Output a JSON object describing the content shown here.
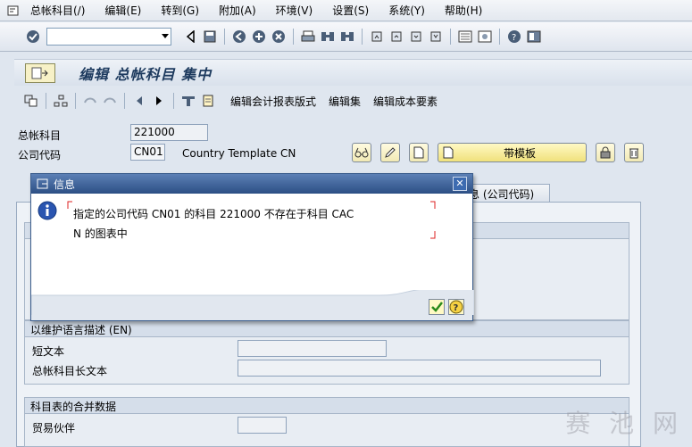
{
  "menu": {
    "items": [
      "总帐科目(/)",
      "编辑(E)",
      "转到(G)",
      "附加(A)",
      "环境(V)",
      "设置(S)",
      "系统(Y)",
      "帮助(H)"
    ]
  },
  "command_field": {
    "value": ""
  },
  "title": "编辑 总帐科目 集中",
  "app_toolbar": {
    "layout_btn": "编辑会计报表版式",
    "set_btn": "编辑集",
    "cost_btn": "编辑成本要素"
  },
  "fields": {
    "gl_label": "总帐科目",
    "gl_value": "221000",
    "company_label": "公司代码",
    "company_value": "CN01",
    "company_name": "Country Template CN"
  },
  "template_button": "带模板",
  "tab_label": "息 (公司代码)",
  "groups": {
    "desc_header": "以维护语言描述 (EN)",
    "short_text_label": "短文本",
    "long_text_label": "总帐科目长文本",
    "consol_header": "科目表的合并数据",
    "partner_label": "贸易伙伴"
  },
  "dialog": {
    "title": "信息",
    "message": "指定的公司代码 CN01 的科目 221000 不存在于科目 CACN 的图表中",
    "line1": "指定的公司代码 CN01 的科目 221000 不存在于科目 CAC",
    "line2": "N 的图表中"
  },
  "watermark": "赛 池 网"
}
